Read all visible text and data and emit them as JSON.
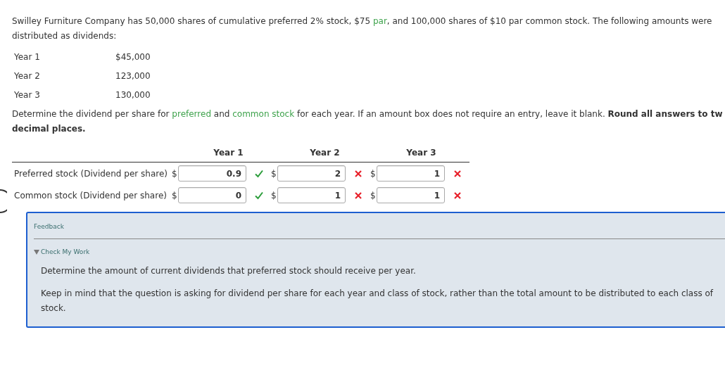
{
  "intro": [
    {
      "kind": "text",
      "text": "Swilley Furniture Company has 50,000 shares of cumulative preferred 2% stock, $75 "
    },
    {
      "kind": "link",
      "text": "par"
    },
    {
      "kind": "text",
      "text": ", and 100,000 shares of $10 par common stock. The following amounts were distributed as dividends:"
    }
  ],
  "distributions": [
    {
      "year": "Year 1",
      "amount": "$45,000"
    },
    {
      "year": "Year 2",
      "amount": "123,000"
    },
    {
      "year": "Year 3",
      "amount": "130,000"
    }
  ],
  "instructions": [
    {
      "kind": "text",
      "text": "Determine the dividend per share for "
    },
    {
      "kind": "link",
      "text": "preferred"
    },
    {
      "kind": "text",
      "text": " and "
    },
    {
      "kind": "link",
      "text": "common stock"
    },
    {
      "kind": "text",
      "text": " for each year. If an amount box does not require an entry, leave it blank. "
    },
    {
      "kind": "bold",
      "text": "Round all answers to tw"
    },
    {
      "kind": "break"
    },
    {
      "kind": "bold",
      "text": "decimal places."
    }
  ],
  "table": {
    "columns": [
      "Year 1",
      "Year 2",
      "Year 3"
    ],
    "rows": [
      {
        "label": "Preferred stock (Dividend per share)",
        "cells": [
          {
            "currency": "$",
            "value": "0.9",
            "correct": true
          },
          {
            "currency": "$",
            "value": "2",
            "correct": false
          },
          {
            "currency": "$",
            "value": "1",
            "correct": false
          }
        ]
      },
      {
        "label": "Common stock (Dividend per share)",
        "cells": [
          {
            "currency": "$",
            "value": "0",
            "correct": true
          },
          {
            "currency": "$",
            "value": "1",
            "correct": false
          },
          {
            "currency": "$",
            "value": "1",
            "correct": false
          }
        ]
      }
    ]
  },
  "feedback": {
    "title": "Feedback",
    "section": "Check My Work",
    "expanded": true,
    "paragraphs": [
      "Determine the amount of current dividends that preferred stock should receive per year.",
      "Keep in mind that the question is asking for dividend per share for each year and class of stock, rather than the total amount to be distributed to each class of stock."
    ]
  }
}
